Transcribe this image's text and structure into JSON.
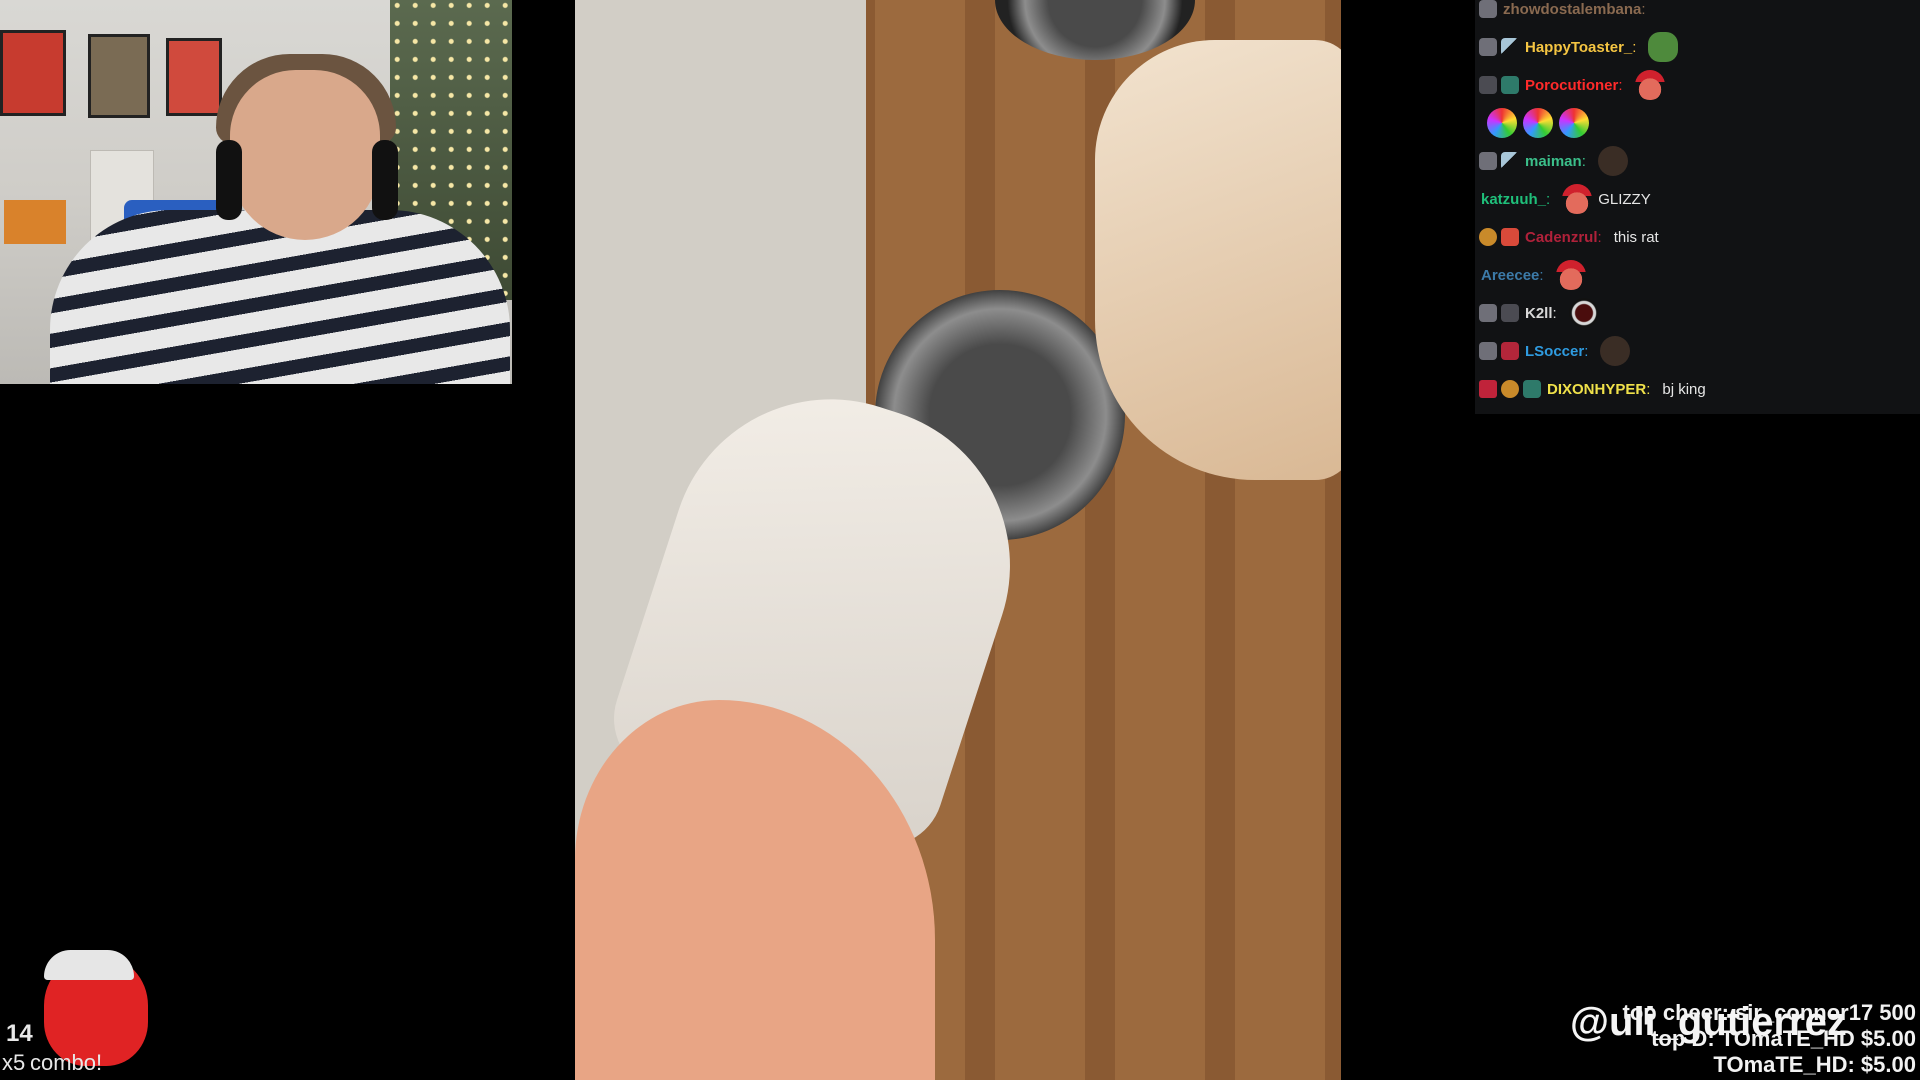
{
  "chat": {
    "messages": [
      {
        "user": "zhowdostalembana",
        "user_color": "#8a6a50",
        "text": "",
        "emote": "",
        "badges": [
          "gray"
        ]
      },
      {
        "user": "HappyToaster_",
        "user_color": "#f5c542",
        "text": "",
        "emote": "pepe",
        "badges": [
          "gray",
          "sword"
        ]
      },
      {
        "user": "Porocutioner",
        "user_color": "#ff2a2a",
        "text": "",
        "emote": "santa",
        "badges": [
          "bar",
          "green"
        ]
      },
      {
        "user": "",
        "user_color": "#2b2b2b",
        "text": "",
        "emote": "rainbow",
        "badges": []
      },
      {
        "user": "maiman",
        "user_color": "#3bbf8a",
        "text": "",
        "emote": "face",
        "badges": [
          "gray",
          "sword"
        ]
      },
      {
        "user": "katzuuh_",
        "user_color": "#1fbf7a",
        "text": "GLIZZY",
        "emote": "santa",
        "badges": []
      },
      {
        "user": "Cadenzrul",
        "user_color": "#b0213a",
        "text": "this rat",
        "emote": "",
        "badges": [
          "crown",
          "gift"
        ]
      },
      {
        "user": "Areecee",
        "user_color": "#3c7aa8",
        "text": "",
        "emote": "santa",
        "badges": []
      },
      {
        "user": "K2ll",
        "user_color": "#d8d8d8",
        "text": "",
        "emote": "ring",
        "badges": [
          "gray",
          "bar"
        ]
      },
      {
        "user": "LSoccer",
        "user_color": "#2f9be0",
        "text": "",
        "emote": "face",
        "badges": [
          "gray",
          "red"
        ]
      },
      {
        "user": "DIXONHYPER",
        "user_color": "#f0e14a",
        "text": "bj king",
        "emote": "",
        "badges": [
          "heart",
          "crown",
          "green"
        ]
      }
    ]
  },
  "combo": {
    "count": "14",
    "multiplier": "x5",
    "label": "combo!"
  },
  "cheers": {
    "top_cheer": "top cheer: sir_connor17 500",
    "top_donation": "top D: TOmaTE_HD $5.00",
    "recent": "TOmaTE_HD: $5.00",
    "handle": "@uli_gutierrez"
  }
}
